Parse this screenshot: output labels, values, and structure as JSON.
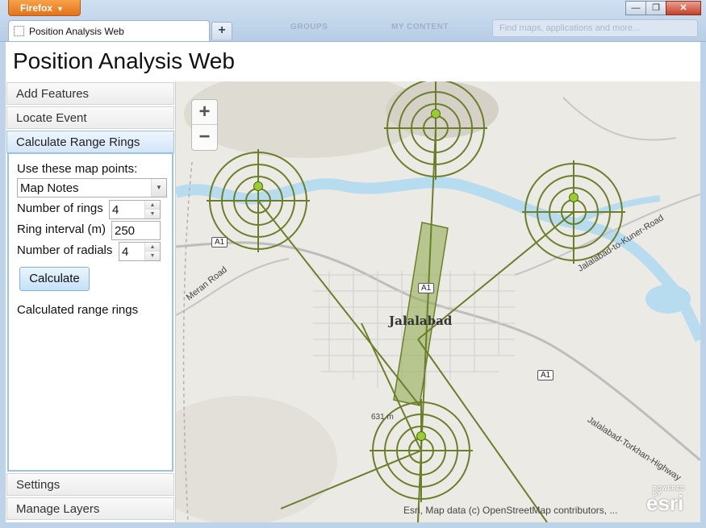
{
  "browser": {
    "menu_label": "Firefox",
    "tab_title": "Position Analysis Web",
    "new_tab": "+",
    "ghost_nav": [
      "GROUPS",
      "MY CONTENT"
    ],
    "ghost_search": "Find maps, applications and more..."
  },
  "window": {
    "minimize": "—",
    "restore": "❐",
    "close": "✕"
  },
  "app": {
    "title": "Position Analysis Web"
  },
  "panel": {
    "sections": [
      "Add Features",
      "Locate Event",
      "Calculate Range Rings",
      "Settings",
      "Manage Layers"
    ],
    "form": {
      "points_label": "Use these map points:",
      "points_value": "Map Notes",
      "rings_label": "Number of rings",
      "rings_value": "4",
      "interval_label": "Ring interval (m)",
      "interval_value": "250",
      "radials_label": "Number of radials",
      "radials_value": "4",
      "calculate_label": "Calculate",
      "result_label": "Calculated range rings"
    }
  },
  "map": {
    "zoom_in": "+",
    "zoom_out": "−",
    "city": "Jalalabad",
    "roads": [
      "Meran Road",
      "Jalalabad-to-Kuner-Road",
      "Jalalabad-Torkhan-Highway"
    ],
    "shields": [
      "A1",
      "A1",
      "A1"
    ],
    "elevation_label": "631 m",
    "attribution": "Esri, Map data (c) OpenStreetMap contributors, ...",
    "logo": "esri",
    "logo_caption": "POWERED BY",
    "ring_color": "#6b7f2a",
    "water_color": "#b7dcef"
  }
}
